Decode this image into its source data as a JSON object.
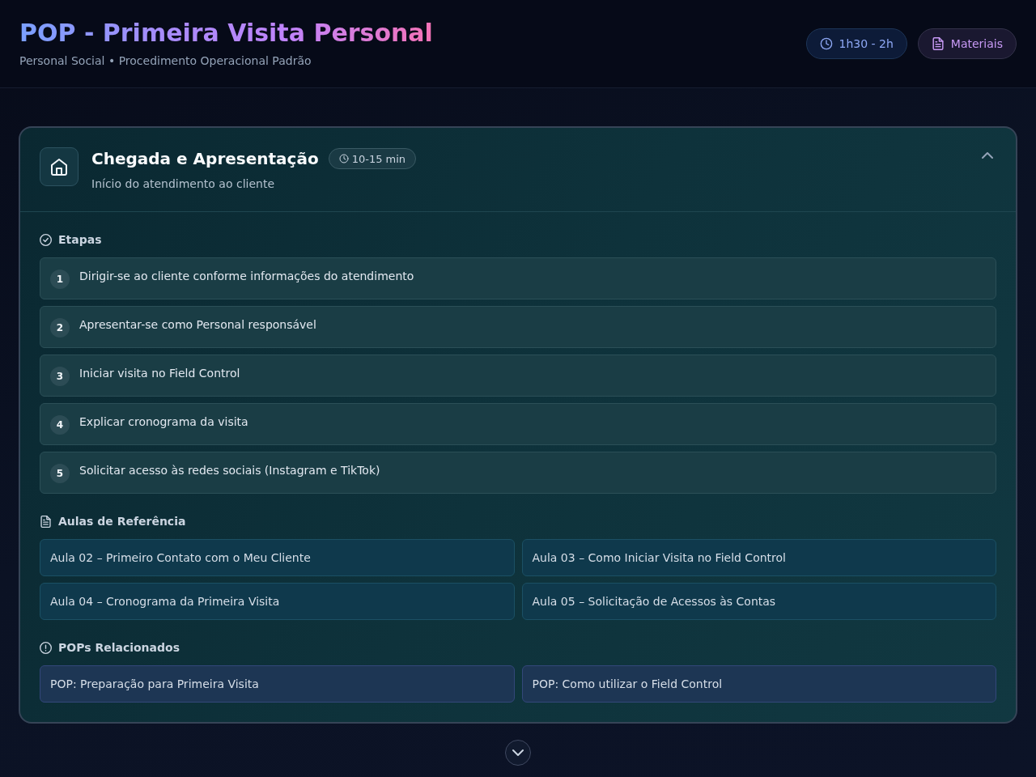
{
  "header": {
    "title": "POP - Primeira Visita Personal",
    "subtitle": "Personal Social • Procedimento Operacional Padrão",
    "badges": [
      {
        "kind": "duration",
        "label": "1h30 - 2h"
      },
      {
        "kind": "materials",
        "label": "Materiais"
      }
    ]
  },
  "section": {
    "title": "Chegada e Apresentação",
    "duration": "10-15 min",
    "subtitle": "Início do atendimento ao cliente",
    "expanded": true,
    "steps_heading": "Etapas",
    "steps": [
      {
        "number": "1",
        "text": "Dirigir-se ao cliente conforme informações do atendimento"
      },
      {
        "number": "2",
        "text": "Apresentar-se como Personal responsável"
      },
      {
        "number": "3",
        "text": "Iniciar visita no Field Control"
      },
      {
        "number": "4",
        "text": "Explicar cronograma da visita"
      },
      {
        "number": "5",
        "text": "Solicitar acesso às redes sociais (Instagram e TikTok)"
      }
    ],
    "lessons_heading": "Aulas de Referência",
    "lessons": [
      "Aula 02 – Primeiro Contato com o Meu Cliente",
      "Aula 03 – Como Iniciar Visita no Field Control",
      "Aula 04 – Cronograma da Primeira Visita",
      "Aula 05 – Solicitação de Acessos às Contas"
    ],
    "related_heading": "POPs Relacionados",
    "related": [
      "POP: Preparação para Primeira Visita",
      "POP: Como utilizar o Field Control"
    ]
  }
}
